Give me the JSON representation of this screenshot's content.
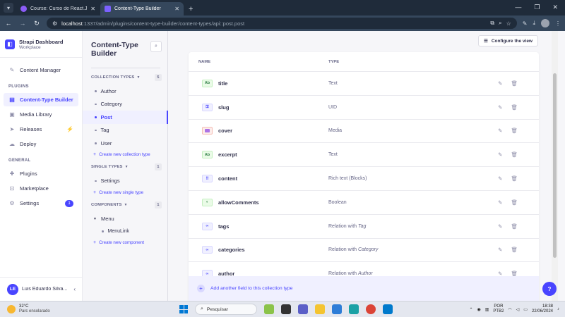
{
  "browser": {
    "tabs": [
      {
        "label": "Course: Curso de React.Js e Ne",
        "active": false
      },
      {
        "label": "Content-Type Builder",
        "active": true
      }
    ],
    "url_host": "localhost",
    "url_path": ":1337/admin/plugins/content-type-builder/content-types/api::post.post"
  },
  "mainnav": {
    "brand_title": "Strapi Dashboard",
    "brand_sub": "Workplace",
    "content_manager": "Content Manager",
    "plugins_section": "PLUGINS",
    "plugins": [
      "Content-Type Builder",
      "Media Library",
      "Releases",
      "Deploy"
    ],
    "general_section": "GENERAL",
    "general": [
      "Plugins",
      "Marketplace",
      "Settings"
    ],
    "settings_count": "1",
    "user_initials": "LE",
    "user_name": "Luis Eduardo Silva..."
  },
  "subnav": {
    "title_line1": "Content-Type",
    "title_line2": "Builder",
    "collection_head": "COLLECTION TYPES",
    "collection_count": "5",
    "collection_items": [
      "Author",
      "Category",
      "Post",
      "Tag",
      "User"
    ],
    "create_collection": "Create new collection type",
    "single_head": "SINGLE TYPES",
    "single_count": "1",
    "single_items": [
      "Settings"
    ],
    "create_single": "Create new single type",
    "components_head": "COMPONENTS",
    "components_count": "1",
    "component_group": "Menu",
    "component_items": [
      "MenuLink"
    ],
    "create_component": "Create new component"
  },
  "content": {
    "configure_view": "Configure the view",
    "col_name": "NAME",
    "col_type": "TYPE",
    "fields": [
      {
        "name": "title",
        "badge": "Ab",
        "type": "Text",
        "target": ""
      },
      {
        "name": "slug",
        "badge": "uid",
        "type": "UID",
        "target": ""
      },
      {
        "name": "cover",
        "badge": "media",
        "type": "Media",
        "target": ""
      },
      {
        "name": "excerpt",
        "badge": "Ab",
        "type": "Text",
        "target": ""
      },
      {
        "name": "content",
        "badge": "rich",
        "type": "Rich text (Blocks)",
        "target": ""
      },
      {
        "name": "allowComments",
        "badge": "bool",
        "type": "Boolean",
        "target": ""
      },
      {
        "name": "tags",
        "badge": "rel",
        "type": "Relation with ",
        "target": "Tag"
      },
      {
        "name": "categories",
        "badge": "rel",
        "type": "Relation with ",
        "target": "Category"
      },
      {
        "name": "author",
        "badge": "rel",
        "type": "Relation with ",
        "target": "Author"
      }
    ],
    "add_field": "Add another field to this collection type"
  },
  "taskbar": {
    "temp": "32°C",
    "weather": "Parc ensolarado",
    "search": "Pesquisar",
    "lang1": "POR",
    "lang2": "PTB2",
    "time": "18:38",
    "date": "22/06/2024"
  },
  "colors": {
    "primary": "#4945ff",
    "text": "#32324d",
    "muted": "#666687"
  }
}
